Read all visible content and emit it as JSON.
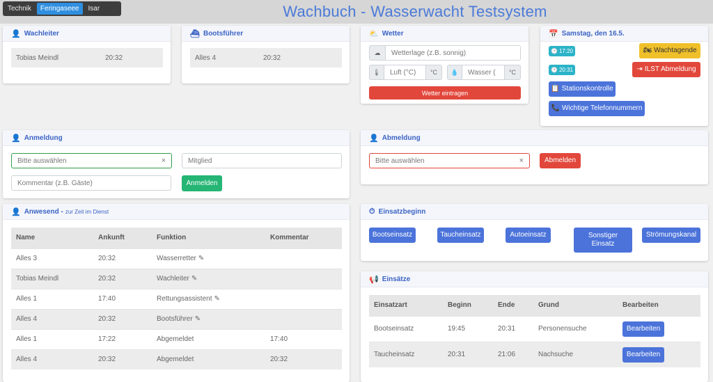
{
  "header": {
    "title": "Wachbuch - Wasserwacht Testsystem",
    "tabs": [
      "Technik",
      "Feringaseee",
      "Isar"
    ],
    "active_tab": "Feringaseee"
  },
  "wachleiter": {
    "title": "Wachleiter",
    "name": "Tobias Meindl",
    "time": "20:32"
  },
  "bootsfuehrer": {
    "title": "Bootsführer",
    "name": "Alles 4",
    "time": "20:32"
  },
  "wetter": {
    "title": "Wetter",
    "wetterlage_placeholder": "Wetterlage (z.B. sonnig)",
    "luft_placeholder": "Luft (°C)",
    "luft_unit": "°C",
    "wasser_placeholder": "Wasser (",
    "wasser_unit": "°C",
    "submit_label": "Wetter eintragen"
  },
  "date_card": {
    "title": "Samstag, den 16.5.",
    "time_badge_1": "17:20",
    "time_badge_2": "20:31",
    "wachtagende_label": "Wachtagende",
    "ilst_label": "ILST Abmeldung",
    "stationskontrolle_label": "Stationskontrolle",
    "telefon_label": "Wichtige Telefonnummern"
  },
  "anmeldung": {
    "title": "Anmeldung",
    "select_value": "Bitte auswählen",
    "mitglied_placeholder": "Mitglied",
    "kommentar_placeholder": "Kommentar (z.B. Gäste)",
    "submit_label": "Anmelden"
  },
  "abmeldung": {
    "title": "Abmeldung",
    "select_value": "Bitte auswählen",
    "submit_label": "Abmelden"
  },
  "anwesend": {
    "title": "Anwesend -",
    "subtitle": "zur Zeit im Dienst",
    "columns": [
      "Name",
      "Ankunft",
      "Funktion",
      "Kommentar"
    ],
    "rows": [
      {
        "name": "Alles 3",
        "ankunft": "20:32",
        "funktion": "Wasserretter",
        "edit": true,
        "kommentar": ""
      },
      {
        "name": "Tobias Meindl",
        "ankunft": "20:32",
        "funktion": "Wachleiter",
        "edit": true,
        "kommentar": ""
      },
      {
        "name": "Alles 1",
        "ankunft": "17:40",
        "funktion": "Rettungsassistent",
        "edit": true,
        "kommentar": ""
      },
      {
        "name": "Alles 4",
        "ankunft": "20:32",
        "funktion": "Bootsführer",
        "edit": true,
        "kommentar": ""
      },
      {
        "name": "Alles 1",
        "ankunft": "17:22",
        "funktion": "Abgemeldet",
        "edit": false,
        "kommentar": "17:40"
      },
      {
        "name": "Alles 4",
        "ankunft": "20:32",
        "funktion": "Abgemeldet",
        "edit": false,
        "kommentar": "20:32"
      }
    ]
  },
  "einsatzbeginn": {
    "title": "Einsatzbeginn",
    "buttons": [
      "Bootseinsatz",
      "Taucheinsatz",
      "Autoeinsatz",
      "Sonstiger Einsatz",
      "Strömungskanal"
    ]
  },
  "einsaetze": {
    "title": "Einsätze",
    "columns": [
      "Einsatzart",
      "Beginn",
      "Ende",
      "Grund",
      "Bearbeiten"
    ],
    "rows": [
      {
        "art": "Bootseinsatz",
        "beginn": "19:45",
        "ende": "20:31",
        "grund": "Personensuche",
        "action": "Bearbeiten"
      },
      {
        "art": "Taucheinsatz",
        "beginn": "20:31",
        "ende": "21:06",
        "grund": "Nachsuche",
        "action": "Bearbeiten"
      }
    ]
  },
  "colors": {
    "accent": "#4b73da",
    "title": "#4a7ad8",
    "success": "#25b574",
    "danger": "#e2473b",
    "warning": "#f0c02a",
    "info": "#2bb3c8"
  }
}
